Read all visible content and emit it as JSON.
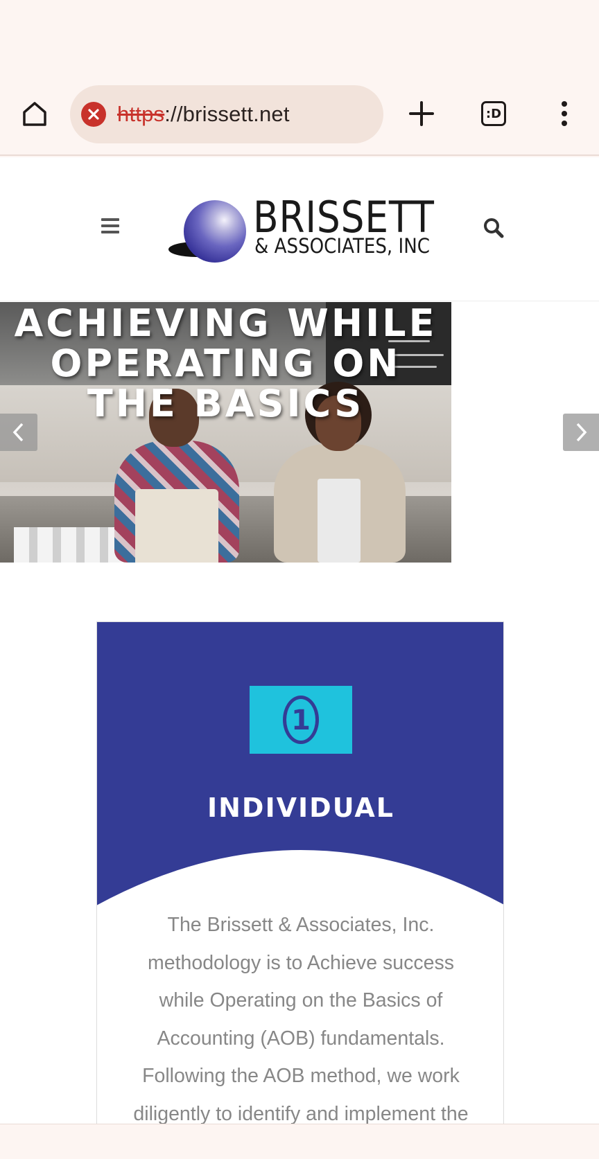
{
  "browser": {
    "url_scheme": "https",
    "url_rest": "://brissett.net",
    "tab_switcher_label": ":D"
  },
  "site": {
    "logo": {
      "name": "BRISSETT",
      "subtitle": "& ASSOCIATES, INC"
    }
  },
  "slider": {
    "headline": [
      "ACHIEVING WHILE",
      "OPERATING ON",
      "THE BASICS"
    ]
  },
  "card": {
    "title": "INDIVIDUAL",
    "body_lines": [
      "The Brissett & Associates, Inc.",
      "methodology is to Achieve success",
      "while Operating on the Basics of",
      "Accounting (AOB) fundamentals.",
      "Following the AOB method, we work",
      "diligently to identify and implement the"
    ],
    "bill_digit": "1"
  },
  "colors": {
    "card_blue": "#343c95",
    "icon_cyan": "#1fc2dd",
    "body_text": "#878787",
    "chrome_bg": "#fdf5f2",
    "url_bar_bg": "#f2e3db",
    "warning_red": "#c8322b"
  },
  "icons": {
    "home": "home-icon",
    "warning": "insecure-warning-icon",
    "new_tab": "plus-icon",
    "tabs": "tab-switcher-icon",
    "menu": "more-vert-icon",
    "nav_menu": "hamburger-icon",
    "search": "search-icon",
    "prev": "chevron-left-icon",
    "next": "chevron-right-icon",
    "bill": "dollar-bill-icon"
  }
}
